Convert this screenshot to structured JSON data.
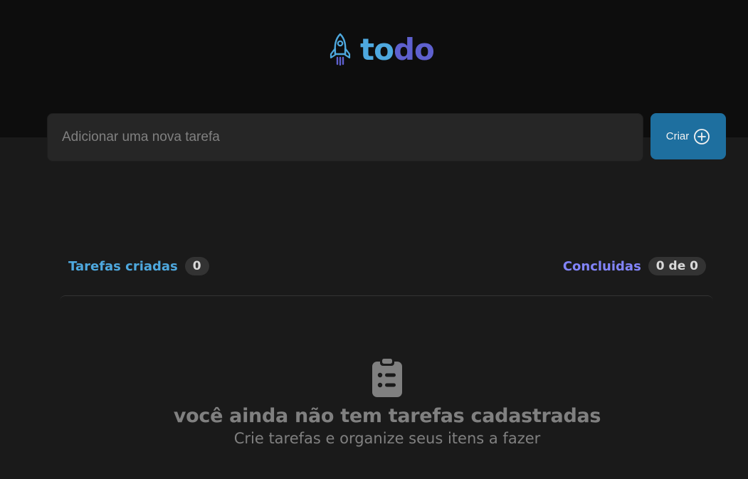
{
  "header": {
    "logo": {
      "part1": "to",
      "part2": "do"
    }
  },
  "new_task": {
    "placeholder": "Adicionar uma nova tarefa",
    "value": "",
    "create_label": "Criar",
    "create_icon": "plus-circle-icon"
  },
  "stats": {
    "created_label": "Tarefas criadas",
    "created_count": "0",
    "done_label": "Concluidas",
    "done_count": "0 de 0"
  },
  "empty_state": {
    "icon": "clipboard-icon",
    "title": "você ainda não tem tarefas cadastradas",
    "subtitle": "Crie tarefas e organize seus itens a fazer"
  },
  "colors": {
    "blue": "#4ea8de",
    "purple": "#5e60ce",
    "purple_light": "#8284fa",
    "button": "#1e6f9f",
    "background": "#1a1a1a",
    "header_background": "#0d0d0d"
  }
}
